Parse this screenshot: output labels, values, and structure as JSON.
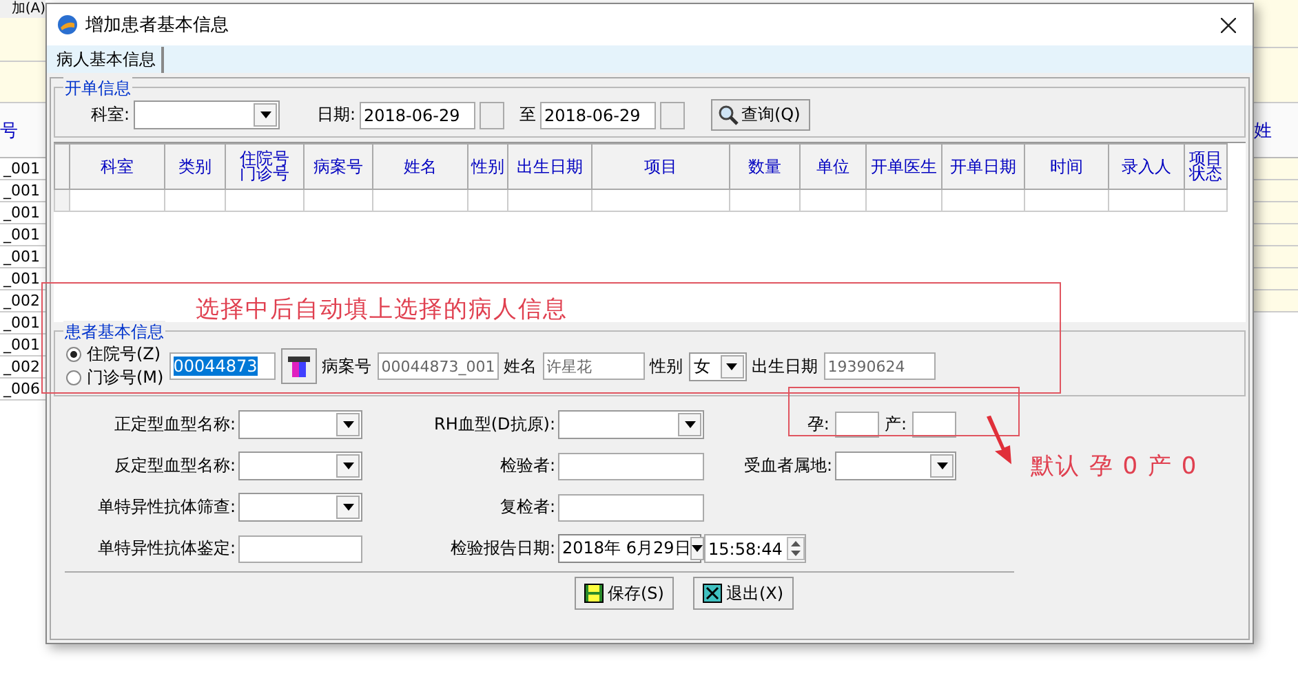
{
  "background": {
    "menu": "加(A)",
    "left_header": "号",
    "left_rows": [
      "_001",
      "_001",
      "_001",
      "_001",
      "_001",
      "_001",
      "_002",
      "_001",
      "_001",
      "_002",
      "_006"
    ],
    "right_header": "姓"
  },
  "dialog": {
    "title": "增加患者基本信息"
  },
  "tabs": [
    {
      "label": "病人基本信息",
      "selected": true
    }
  ],
  "order_info": {
    "title": "开单信息",
    "department_label": "科室:",
    "date_label": "日期:",
    "date_from": "2018-06-29",
    "to_label": "至",
    "date_to": "2018-06-29",
    "query_button": "查询(Q)"
  },
  "table": {
    "columns": [
      {
        "label": "科室"
      },
      {
        "label": "类别"
      },
      {
        "label": "住院号门诊号"
      },
      {
        "label": "病案号"
      },
      {
        "label": "姓名"
      },
      {
        "label": "性别"
      },
      {
        "label": "出生日期"
      },
      {
        "label": "项目"
      },
      {
        "label": "数量"
      },
      {
        "label": "单位"
      },
      {
        "label": "开单医生"
      },
      {
        "label": "开单日期"
      },
      {
        "label": "时间"
      },
      {
        "label": "录入人"
      },
      {
        "label": "项目状态"
      }
    ]
  },
  "patient": {
    "title": "患者基本信息",
    "id_types": [
      {
        "label": "住院号(Z)",
        "selected": true
      },
      {
        "label": "门诊号(M)",
        "selected": false
      }
    ],
    "id_value": "00044873",
    "case_label": "病案号",
    "case_value": "00044873_001",
    "name_label": "姓名",
    "name_value": "许星花",
    "sex_label": "性别",
    "sex_value": "女",
    "birth_label": "出生日期",
    "birth_value": "19390624"
  },
  "form": {
    "rows": [
      [
        {
          "kind": "combo",
          "label": "正定型血型名称:"
        },
        {
          "kind": "combo",
          "label": "RH血型(D抗原):"
        },
        {
          "kind": "pair",
          "labels": [
            "孕:",
            "产:"
          ]
        }
      ],
      [
        {
          "kind": "combo",
          "label": "反定型血型名称:"
        },
        {
          "kind": "input",
          "label": "检验者:"
        },
        {
          "kind": "combo",
          "label": "受血者属地:"
        }
      ],
      [
        {
          "kind": "combo",
          "label": "单特异性抗体筛查:"
        },
        {
          "kind": "input",
          "label": "复检者:"
        }
      ],
      [
        {
          "kind": "input",
          "label": "单特异性抗体鉴定:"
        },
        {
          "kind": "datetime",
          "label": "检验报告日期:",
          "date": "2018年 6月29日",
          "time": "15:58:44"
        }
      ]
    ]
  },
  "buttons": [
    {
      "kind": "save",
      "label": "保存(S)"
    },
    {
      "kind": "exit",
      "label": "退出(X)"
    }
  ],
  "annotations": [
    {
      "kind": "box",
      "text": "选择中后自动填上选择的病人信息"
    },
    {
      "kind": "arrow",
      "text": "默认 孕 0 产 0"
    }
  ]
}
